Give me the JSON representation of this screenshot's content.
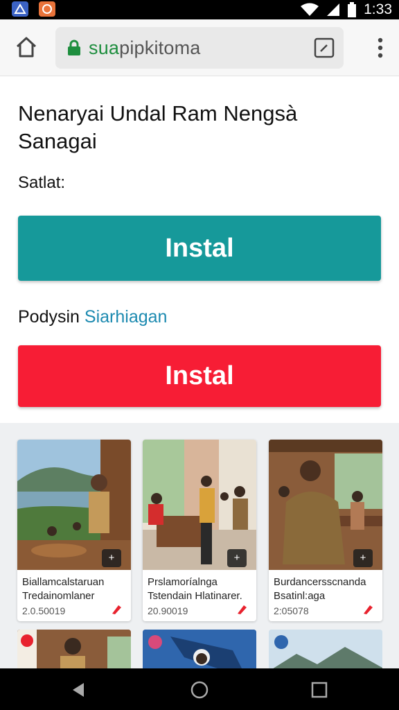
{
  "status": {
    "time": "1:33",
    "icons": [
      "app-icon-blue",
      "app-icon-orange",
      "wifi-icon",
      "signal-icon",
      "battery-icon"
    ]
  },
  "browser": {
    "url_domain": "sua",
    "url_rest": "pipkitoma",
    "icons": [
      "home-icon",
      "lock-icon",
      "external-link-icon",
      "more-vert-icon"
    ],
    "lock_color": "#1e8e3e"
  },
  "page": {
    "title": "Nenaryai Undal Ram Nengsà Sanagai",
    "label1": "Satlat:",
    "install_primary": "Instal",
    "label2_prefix": "Podysin",
    "label2_link": "Siarhiagan",
    "install_secondary": "Instal",
    "colors": {
      "teal": "#16999a",
      "red": "#f71d35",
      "link": "#1c8ab0"
    }
  },
  "gallery": {
    "cards": [
      {
        "title1": "Biallamcalstaruan",
        "title2": "Tredainomlaner",
        "date": "2.0.50019"
      },
      {
        "title1": "Prslamoríalnga",
        "title2": "Tstendain Hlatinarer.",
        "date": "20.90019"
      },
      {
        "title1": "Burdancersscnanda",
        "title2": "Bsatinl:aga",
        "date": "2:05078"
      }
    ],
    "badge_icons": [
      "resize-icon",
      "move-icon",
      "crop-icon"
    ]
  },
  "navbar": {
    "icons": [
      "back-icon",
      "home-circle-icon",
      "recents-icon"
    ]
  }
}
